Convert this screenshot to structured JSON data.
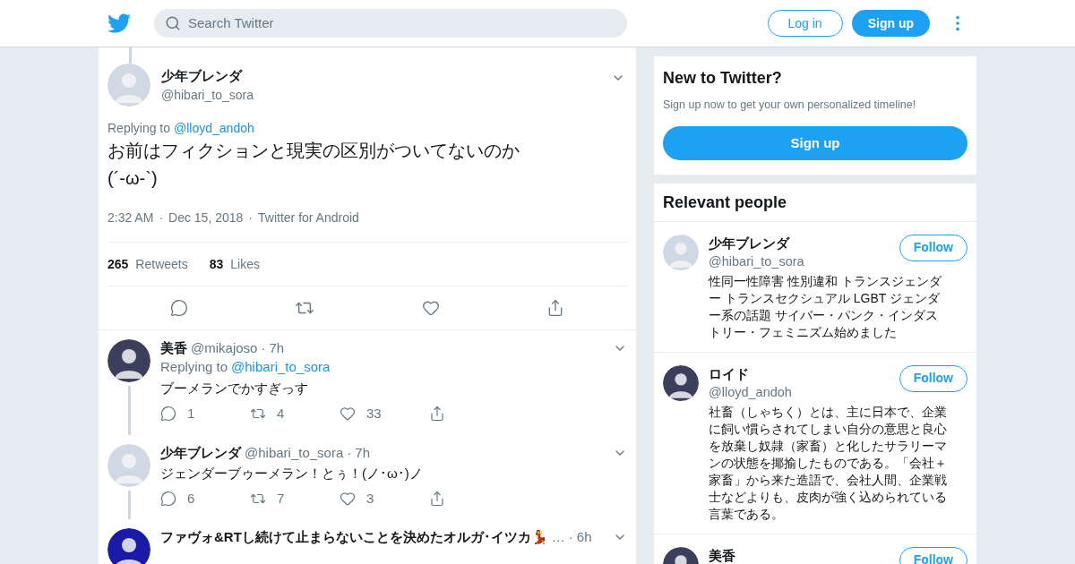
{
  "header": {
    "search_placeholder": "Search Twitter",
    "login": "Log in",
    "signup": "Sign up"
  },
  "main_tweet": {
    "name": "少年ブレンダ",
    "handle": "@hibari_to_sora",
    "replying_label": "Replying to",
    "replying_to": "@lloyd_andoh",
    "text": "お前はフィクションと現実の区別がついてないのか",
    "emoticon": "(´-ω-`)",
    "time": "2:32 AM",
    "separator": "·",
    "date": "Dec 15, 2018",
    "source": "Twitter for Android",
    "retweets": "265",
    "retweets_label": "Retweets",
    "likes": "83",
    "likes_label": "Likes"
  },
  "replies": [
    {
      "name": "美香",
      "handle": "@mikajoso",
      "separator": "·",
      "time": "7h",
      "replying_label": "Replying to",
      "replying_to": "@hibari_to_sora",
      "text": "ブーメランでかすぎっす",
      "replies": "1",
      "retweets": "4",
      "likes": "33"
    },
    {
      "name": "少年ブレンダ",
      "handle": "@hibari_to_sora",
      "separator": "·",
      "time": "7h",
      "text": "ジェンダーブゥーメラン！とぅ！(ノ･ω･)ノ",
      "replies": "6",
      "retweets": "7",
      "likes": "3"
    },
    {
      "name": "ファヴォ&RTし続けて止まらないことを決めたオルガ･イツカ💃",
      "handle": "…",
      "separator": "·",
      "time": "6h"
    }
  ],
  "sidebar": {
    "new_to_twitter": {
      "title": "New to Twitter?",
      "subtitle": "Sign up now to get your own personalized timeline!",
      "button": "Sign up"
    },
    "relevant_people": {
      "title": "Relevant people",
      "people": [
        {
          "name": "少年ブレンダ",
          "handle": "@hibari_to_sora",
          "bio": "性同一性障害 性別違和 トランスジェンダー トランスセクシュアル LGBT ジェンダー系の話題 サイバー・パンク・インダストリー・フェミニズム始めました",
          "button": "Follow"
        },
        {
          "name": "ロイド",
          "handle": "@lloyd_andoh",
          "bio": "社畜（しゃちく）とは、主に日本で、企業に飼い慣らされてしまい自分の意思と良心を放棄し奴隷（家畜）と化したサラリーマンの状態を揶揄したものである。「会社＋家畜」から来た造語で、会社人間、企業戦士などよりも、皮肉が強く込められている言葉である。",
          "button": "Follow"
        },
        {
          "name": "美香",
          "button": "Follow"
        }
      ]
    }
  }
}
